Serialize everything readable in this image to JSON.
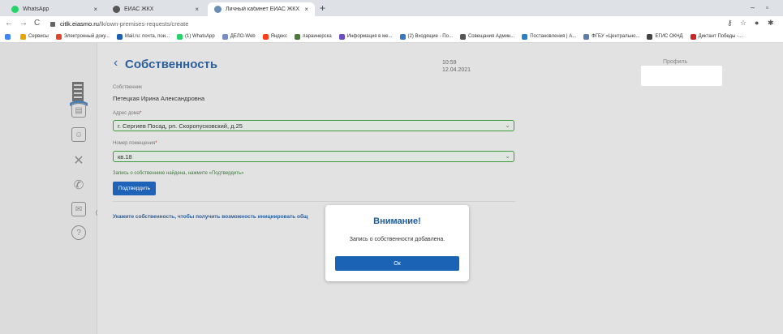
{
  "browser": {
    "tabs": [
      {
        "label": "WhatsApp",
        "close": "×",
        "icon_color": "#25d366"
      },
      {
        "label": "ЕИАС ЖКХ",
        "close": "×",
        "icon_color": "#555555"
      },
      {
        "label": "Личный кабинет ЕИАС ЖКХ",
        "close": "×",
        "icon_color": "#6a8fb5"
      }
    ],
    "new_tab": "+",
    "minimize": "–",
    "restore": "▫",
    "url_host": "citlk.eiasmo.ru",
    "url_path": "/lk/own-premises-requests/create",
    "bookmarks": [
      {
        "label": "Сервисы",
        "color": "#e8a400"
      },
      {
        "label": "Электронный доку...",
        "color": "#e0462b"
      },
      {
        "label": "Mail.ru: почта, пои...",
        "color": "#1a5fb4"
      },
      {
        "label": "(1) WhatsApp",
        "color": "#25d366"
      },
      {
        "label": "ДЕЛО-Web",
        "color": "#7a8cc7"
      },
      {
        "label": "Яндекс",
        "color": "#fc3f1d"
      },
      {
        "label": "лараинерска",
        "color": "#4a7a35"
      },
      {
        "label": "Информация в ме...",
        "color": "#6b4cc2"
      },
      {
        "label": "(2) Входящие - По...",
        "color": "#3b78c2"
      },
      {
        "label": "Совещания Админ...",
        "color": "#555555"
      },
      {
        "label": "Постановления | А...",
        "color": "#2a7fc9"
      },
      {
        "label": "ФГБУ «Центрально...",
        "color": "#5b7ea8"
      },
      {
        "label": "ЕГИС ОКНД",
        "color": "#444444"
      },
      {
        "label": "Диктант Победы -...",
        "color": "#c62828"
      }
    ]
  },
  "header": {
    "back_icon": "‹",
    "title": "Собственность",
    "time": "10:59",
    "date": "12.04.2021",
    "profile_label": "Профиль"
  },
  "form": {
    "owner_label": "Собственник",
    "owner_name": "Петецкая Ирина Александровна",
    "address_label": "Адрес дома",
    "address_value": "г. Сергиев Посад, рп. Скоропусковский, д.25",
    "room_label": "Номер помещения",
    "room_value": "кв.18",
    "required_mark": "*",
    "found_message": "Запись о собственнике найдена, нажмите «Подтвердить»",
    "confirm_button": "Подтвердить",
    "hint": "Укажите собственность, чтобы получить возможность инициировать общ"
  },
  "modal": {
    "title": "Внимание!",
    "message": "Запись о собственности добавлена.",
    "ok_button": "Ок"
  },
  "colors": {
    "accent": "#1a63b5",
    "title": "#2b5e9a",
    "success_border": "#3c9b3c"
  }
}
